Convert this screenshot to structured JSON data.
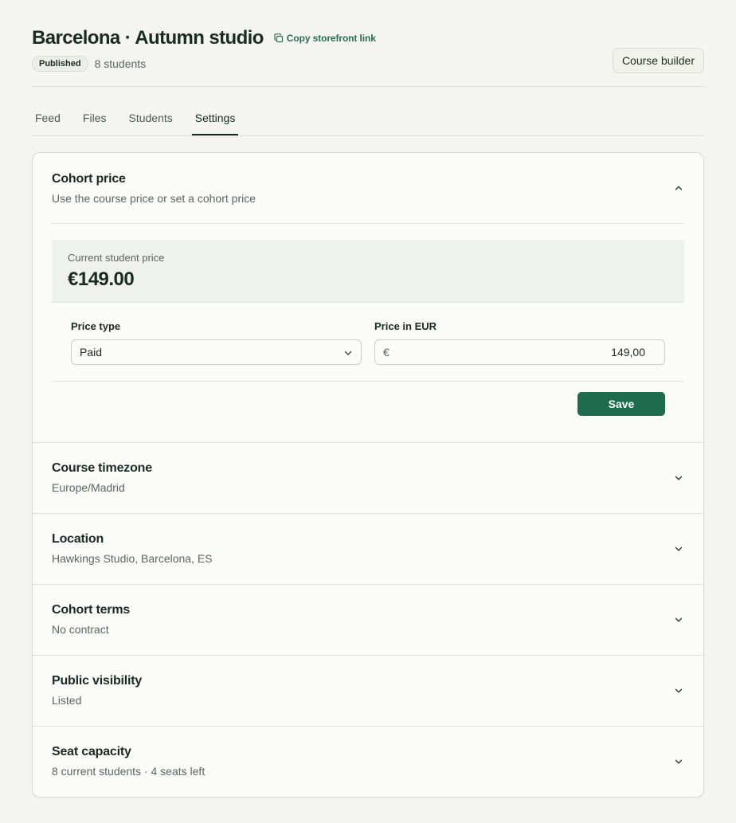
{
  "header": {
    "title": "Barcelona · Autumn studio",
    "copy_link": "Copy storefront link",
    "status_badge": "Published",
    "students_count": "8 students",
    "course_builder_label": "Course builder"
  },
  "tabs": [
    {
      "label": "Feed",
      "active": false
    },
    {
      "label": "Files",
      "active": false
    },
    {
      "label": "Students",
      "active": false
    },
    {
      "label": "Settings",
      "active": true
    }
  ],
  "settings": {
    "cohort_price": {
      "title": "Cohort price",
      "subtitle": "Use the course price or set a cohort price",
      "expanded": true,
      "current_label": "Current student price",
      "current_value": "€149.00",
      "price_type_label": "Price type",
      "price_type_value": "Paid",
      "price_eur_label": "Price in EUR",
      "currency_symbol": "€",
      "price_eur_value": "149,00",
      "save_label": "Save"
    },
    "sections": [
      {
        "title": "Course timezone",
        "subtitle": "Europe/Madrid"
      },
      {
        "title": "Location",
        "subtitle": "Hawkings Studio, Barcelona, ES"
      },
      {
        "title": "Cohort terms",
        "subtitle": "No contract"
      },
      {
        "title": "Public visibility",
        "subtitle": "Listed"
      },
      {
        "title": "Seat capacity",
        "subtitle": "8 current students · 4 seats left"
      }
    ]
  },
  "colors": {
    "accent": "#1f6b4d",
    "background": "#f4f5f0",
    "card": "#fbfcf8"
  }
}
